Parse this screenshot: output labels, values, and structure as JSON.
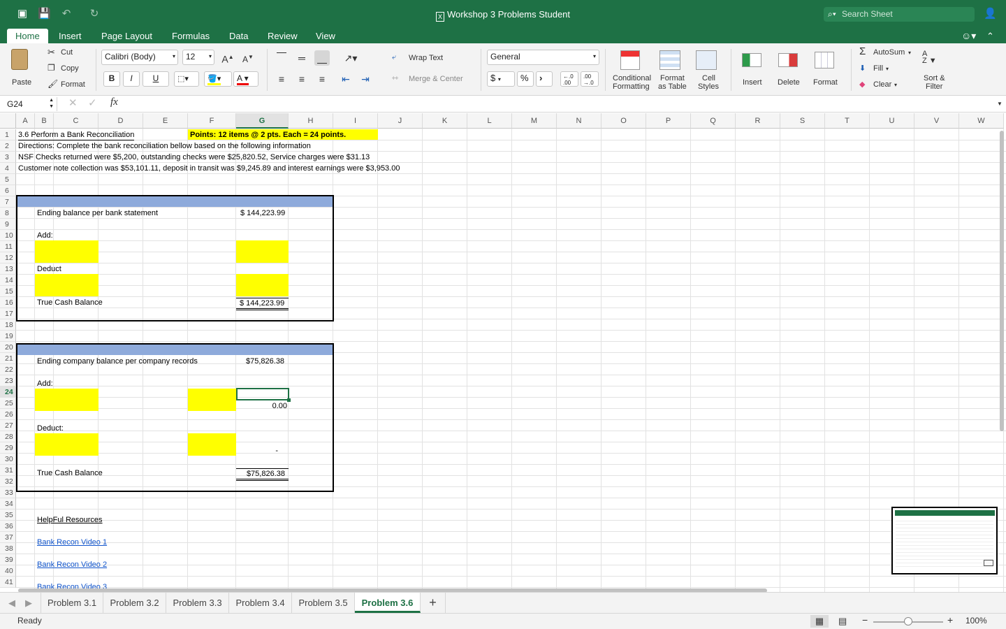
{
  "window": {
    "title": "Workshop 3 Problems Student",
    "search_placeholder": "Search Sheet"
  },
  "ribbon_tabs": [
    "Home",
    "Insert",
    "Page Layout",
    "Formulas",
    "Data",
    "Review",
    "View"
  ],
  "ribbon": {
    "paste": "Paste",
    "cut": "Cut",
    "copy": "Copy",
    "format_painter": "Format",
    "font_name": "Calibri (Body)",
    "font_size": "12",
    "bold": "B",
    "italic": "I",
    "underline": "U",
    "wrap_text": "Wrap Text",
    "merge_center": "Merge & Center",
    "number_format": "General",
    "currency": "$",
    "percent": "%",
    "comma": "›",
    "conditional_formatting_1": "Conditional",
    "conditional_formatting_2": "Formatting",
    "format_as_table_1": "Format",
    "format_as_table_2": "as Table",
    "cell_styles_1": "Cell",
    "cell_styles_2": "Styles",
    "insert": "Insert",
    "delete": "Delete",
    "format": "Format",
    "autosum": "AutoSum",
    "fill": "Fill",
    "clear": "Clear",
    "sort_filter_1": "Sort &",
    "sort_filter_2": "Filter"
  },
  "formula_bar": {
    "name_box": "G24",
    "fx": "fx",
    "content": ""
  },
  "columns": [
    "A",
    "B",
    "C",
    "D",
    "E",
    "F",
    "G",
    "H",
    "I",
    "J",
    "K",
    "L",
    "M",
    "N",
    "O",
    "P",
    "Q",
    "R",
    "S",
    "T",
    "U",
    "V",
    "W"
  ],
  "rows": [
    "1",
    "2",
    "3",
    "4",
    "5",
    "6",
    "7",
    "8",
    "9",
    "10",
    "11",
    "12",
    "13",
    "14",
    "15",
    "16",
    "17",
    "18",
    "19",
    "20",
    "21",
    "22",
    "23",
    "24",
    "25",
    "26",
    "27",
    "28",
    "29",
    "30",
    "31",
    "32",
    "33",
    "34",
    "35",
    "36",
    "37",
    "38",
    "39",
    "40",
    "41"
  ],
  "selected_cell": "G24",
  "cells": {
    "r1_title": "3.6 Perform a Bank Reconciliation",
    "r1_points": "Points:  12 items @ 2 pts. Each = 24 points.",
    "r2": "Directions: Complete the bank reconciliation bellow based on the following information",
    "r3": "NSF Checks returned were $5,200, outstanding checks were $25,820.52, Service charges were $31.13",
    "r4": "Customer note collection was $53,101.11, deposit in transit was $9,245.89 and interest earnings were $3,953.00",
    "r8_label": "Ending balance per bank statement",
    "r8_value": "$ 144,223.99",
    "r10_label": "Add:",
    "r13_label": "Deduct",
    "r16_label": "True Cash Balance",
    "r16_value": "$ 144,223.99",
    "r21_label": "Ending company balance per company records",
    "r21_value": "$75,826.38",
    "r23_label": "Add:",
    "r25_value": "0.00",
    "r27_label": "Deduct:",
    "r29_value": "-",
    "r31_label": "True Cash Balance",
    "r31_value": "$75,826.38",
    "r35_label": "HelpFul Resources",
    "r37_link": "Bank Recon Video 1",
    "r39_link": "Bank Recon Video 2",
    "r41_link": "Bank Recon Video 3"
  },
  "sheet_tabs": [
    "Problem 3.1",
    "Problem 3.2",
    "Problem 3.3",
    "Problem 3.4",
    "Problem 3.5",
    "Problem 3.6"
  ],
  "active_sheet": "Problem 3.6",
  "status": {
    "ready": "Ready",
    "zoom": "100%"
  },
  "colors": {
    "excel_green": "#1e7145",
    "highlight_yellow": "#ffff00",
    "header_blue": "#8eaadb",
    "link_blue": "#1155cc"
  }
}
